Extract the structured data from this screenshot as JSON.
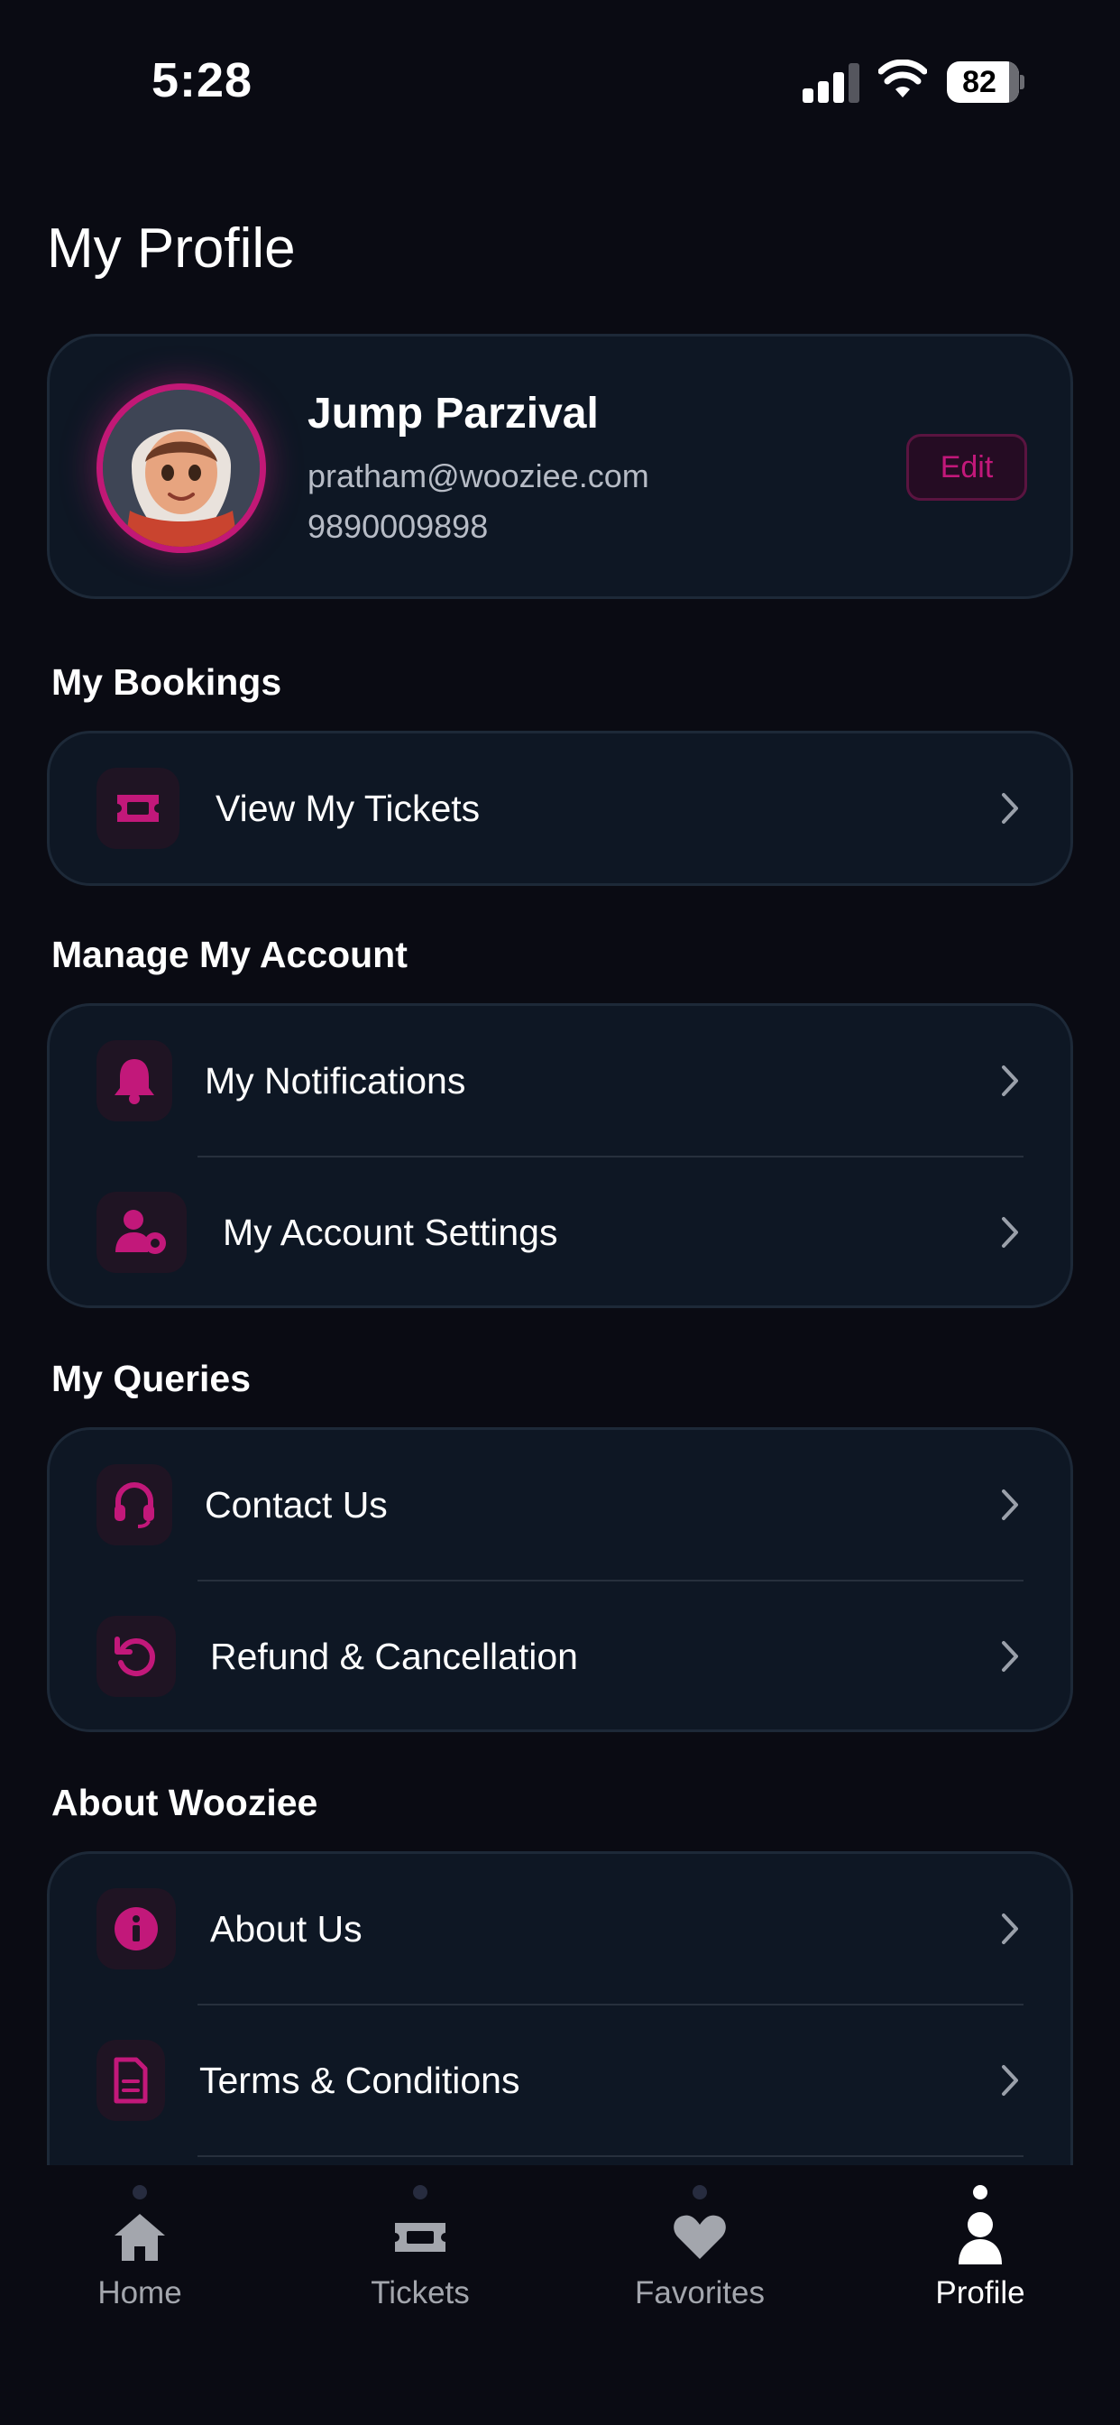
{
  "status_bar": {
    "time": "5:28",
    "battery": "82"
  },
  "page": {
    "title": "My Profile"
  },
  "profile": {
    "name": "Jump Parzival",
    "email": "pratham@wooziee.com",
    "phone": "9890009898",
    "edit_label": "Edit"
  },
  "sections": {
    "bookings": {
      "title": "My Bookings",
      "items": [
        {
          "label": "View My Tickets",
          "icon": "ticket-icon"
        }
      ]
    },
    "account": {
      "title": "Manage My Account",
      "items": [
        {
          "label": "My Notifications",
          "icon": "bell-icon"
        },
        {
          "label": "My Account Settings",
          "icon": "user-gear-icon"
        }
      ]
    },
    "queries": {
      "title": "My Queries",
      "items": [
        {
          "label": "Contact Us",
          "icon": "headset-icon"
        },
        {
          "label": "Refund & Cancellation",
          "icon": "undo-icon"
        }
      ]
    },
    "about": {
      "title": "About Wooziee",
      "items": [
        {
          "label": "About Us",
          "icon": "info-icon"
        },
        {
          "label": "Terms & Conditions",
          "icon": "document-icon"
        }
      ]
    }
  },
  "tab_bar": {
    "tabs": [
      {
        "label": "Home",
        "icon": "home-icon"
      },
      {
        "label": "Tickets",
        "icon": "ticket-icon"
      },
      {
        "label": "Favorites",
        "icon": "heart-icon"
      },
      {
        "label": "Profile",
        "icon": "person-icon"
      }
    ],
    "active": "Profile"
  },
  "colors": {
    "accent": "#c2187a",
    "background": "#0a0b13",
    "card": "#0e1724",
    "card_border": "#1d2938"
  }
}
